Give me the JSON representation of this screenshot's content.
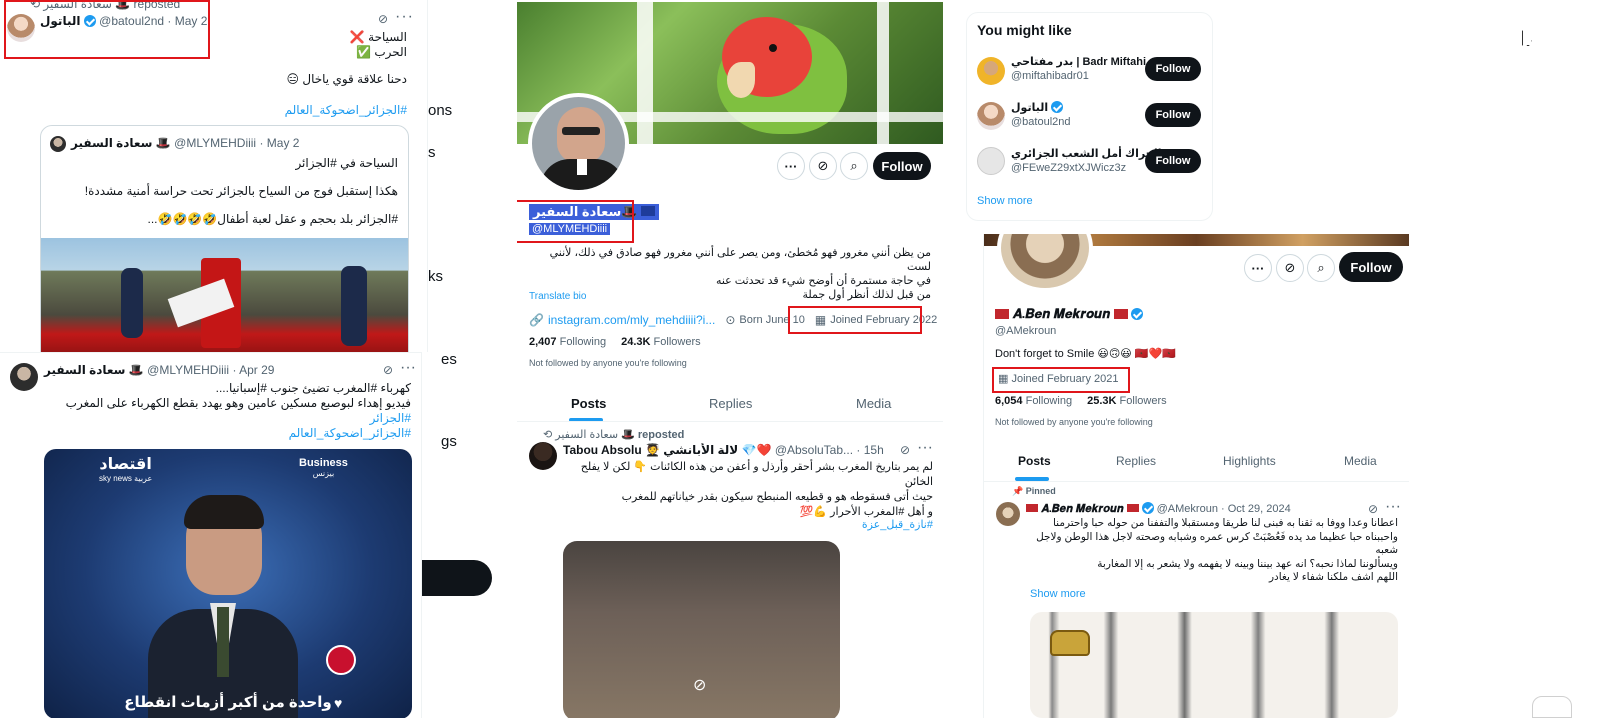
{
  "colors": {
    "accent": "#1d9bf0",
    "highlight_box": "#e0161b",
    "follow_button": "#0f1419"
  },
  "left": {
    "repost_label": "reposted",
    "repost_by": "سعادة السفير",
    "post1": {
      "name": "الباتول",
      "handle": "@batoul2nd",
      "date": "· May 2",
      "line1": "السياحة ❌",
      "line2": "الحرب ✅",
      "line3": "دحنا علاقة قوي ياخال 😑",
      "hashtag": "#الجزائر_اضحوكة_العالم"
    },
    "quote": {
      "name": "سعادة السفير",
      "handle": "@MLYMEHDiiii",
      "date": "· May 2",
      "line1": "السياحة في #الجزائر",
      "line2": "هكذا إستقبل فوج من السياح بالجزائر تحت حراسة أمنية مشددة!",
      "line3": "#الجزائر بلد بحجم و عقل لعبة أطفال🤣🤣🤣🤣..."
    },
    "side_fragments": [
      "ons",
      "s",
      "ks",
      "es",
      "gs"
    ],
    "post2": {
      "name": "سعادة السفير",
      "handle": "@MLYMEHDiiii",
      "date": "· Apr 29",
      "line1": "كهرباء #المغرب تضيئ جنوب #إسبانيا....",
      "line2": "فيديو إهداء لبوصبع مسكين عامين وهو يهدد بقطع الكهرباء على المغرب",
      "tag1": "#الجزائر",
      "tag2": "#الجزائر_اضحوكة_العالم",
      "video_logo_left": "اقتصاد",
      "video_logo_left_sub": "sky news عربية",
      "video_logo_right": "Business",
      "video_logo_right_sub": "بيزنس",
      "video_caption": "واحدة من أكبر أزمات انقطاع"
    }
  },
  "middle": {
    "name": "سعادة السفير",
    "handle": "@MLYMEHDiiii",
    "follow": "Follow",
    "bio_line1": "من يظن أنني مغرور فهو مُخطئ، ومن يصر على أنني مغرور فهو صادق في ذلك، لأنني لست",
    "bio_line2": "في حاجة مستمرة أن أوضح شيء قد تحدثت عنه",
    "bio_line3": "من قبل لذلك أنظر أول جملة",
    "translate": "Translate bio",
    "website": "instagram.com/mly_mehdiiii?i...",
    "born": "Born June 10",
    "joined": "Joined February 2022",
    "following_count": "2,407",
    "following_label": "Following",
    "followers_count": "24.3K",
    "followers_label": "Followers",
    "not_followed": "Not followed by anyone you're following",
    "tabs": [
      "Posts",
      "Replies",
      "Media"
    ],
    "repost_by": "سعادة السفير",
    "repost_label": "reposted",
    "tweet": {
      "name": "Tabou Absolu 🧑‍🎓 لالة الأبانشي 💎❤️",
      "handle": "@AbsoluTab...",
      "date": "· 15h",
      "line1": "لم يمر بتاريخ المغرب بشر أحقر وأرذل و أعفن من هذه الكائنات 👇 لكن لا يفلح الخائن",
      "line2": "حيث أتى فسقوطه هو و قطيعه المنبطح سيكون بقدر خياناتهم للمغرب",
      "line3": "و أهل #المغرب الأحرار 💪💯",
      "tag": "#نازة_قبل_عزة"
    }
  },
  "right": {
    "you_might_like": "You might like",
    "suggestions": [
      {
        "name": "بدر مفتاحي | Badr Miftahi",
        "handle": "@miftahibadr01",
        "button": "Follow",
        "verified": false
      },
      {
        "name": "الباتول",
        "handle": "@batoul2nd",
        "button": "Follow",
        "verified": true
      },
      {
        "name": "الحراك أمل الشعب الجزائري",
        "handle": "@FEweZ29xtXJWicz3z",
        "button": "Follow",
        "verified": false
      }
    ],
    "show_more": "Show more",
    "profile": {
      "name": "𝑨.𝑩𝒆𝒏 𝑴𝒆𝒌𝒓𝒐𝒖𝒏",
      "handle": "@AMekroun",
      "follow": "Follow",
      "bio": "Don't forget to Smile 😃🙃😃 🇲🇦❤️🇲🇦",
      "joined": "Joined February 2021",
      "following_count": "6,054",
      "following_label": "Following",
      "followers_count": "25.3K",
      "followers_label": "Followers",
      "not_followed": "Not followed by anyone you're following",
      "tabs": [
        "Posts",
        "Replies",
        "Highlights",
        "Media"
      ],
      "pinned": "Pinned",
      "post": {
        "name": "𝑨.𝑩𝒆𝒏 𝑴𝒆𝒌𝒓𝒐𝒖𝒏",
        "handle": "@AMekroun",
        "date": "· Oct 29, 2024",
        "line1": "اعطانا وعدا ووفا به ثقنا به فبنى لنا طريقا ومستقبلا والتففنا من حوله حبا واحترمنا",
        "line2": "واحببناه حبا عظيما مد يده فَعُصْبَتْ كرس عمره وشبابه وصحته لاجل هذا الوطن ولاجل",
        "line3": "شعبه",
        "line4": "ويسألوننا لماذا نحبه؟ انه عهد بيننا وبينه لا يفهمه ولا يشعر به إلا المغاربة",
        "line5": "اللهم اشف ملكنا شفاء لا يغادر",
        "show_more": "Show more"
      }
    }
  }
}
